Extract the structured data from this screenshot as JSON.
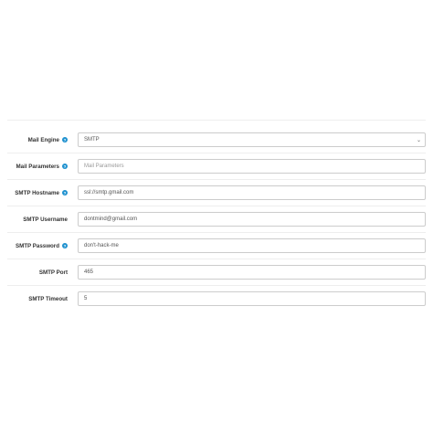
{
  "form": {
    "mail_engine": {
      "label": "Mail Engine",
      "value": "SMTP"
    },
    "mail_parameters": {
      "label": "Mail Parameters",
      "placeholder": "Mail Parameters"
    },
    "smtp_hostname": {
      "label": "SMTP Hostname",
      "value": "ssl://smtp.gmail.com"
    },
    "smtp_username": {
      "label": "SMTP Username",
      "value": "dontmind@gmail.com"
    },
    "smtp_password": {
      "label": "SMTP Password",
      "value": "don't-hack-me"
    },
    "smtp_port": {
      "label": "SMTP Port",
      "value": "465"
    },
    "smtp_timeout": {
      "label": "SMTP Timeout",
      "value": "5"
    }
  },
  "icons": {
    "help": "question-circle-icon",
    "dropdown": "chevron-down-icon"
  },
  "colors": {
    "help_icon": "#1e91cf",
    "border": "#cccccc",
    "divider": "#eeeeee"
  }
}
